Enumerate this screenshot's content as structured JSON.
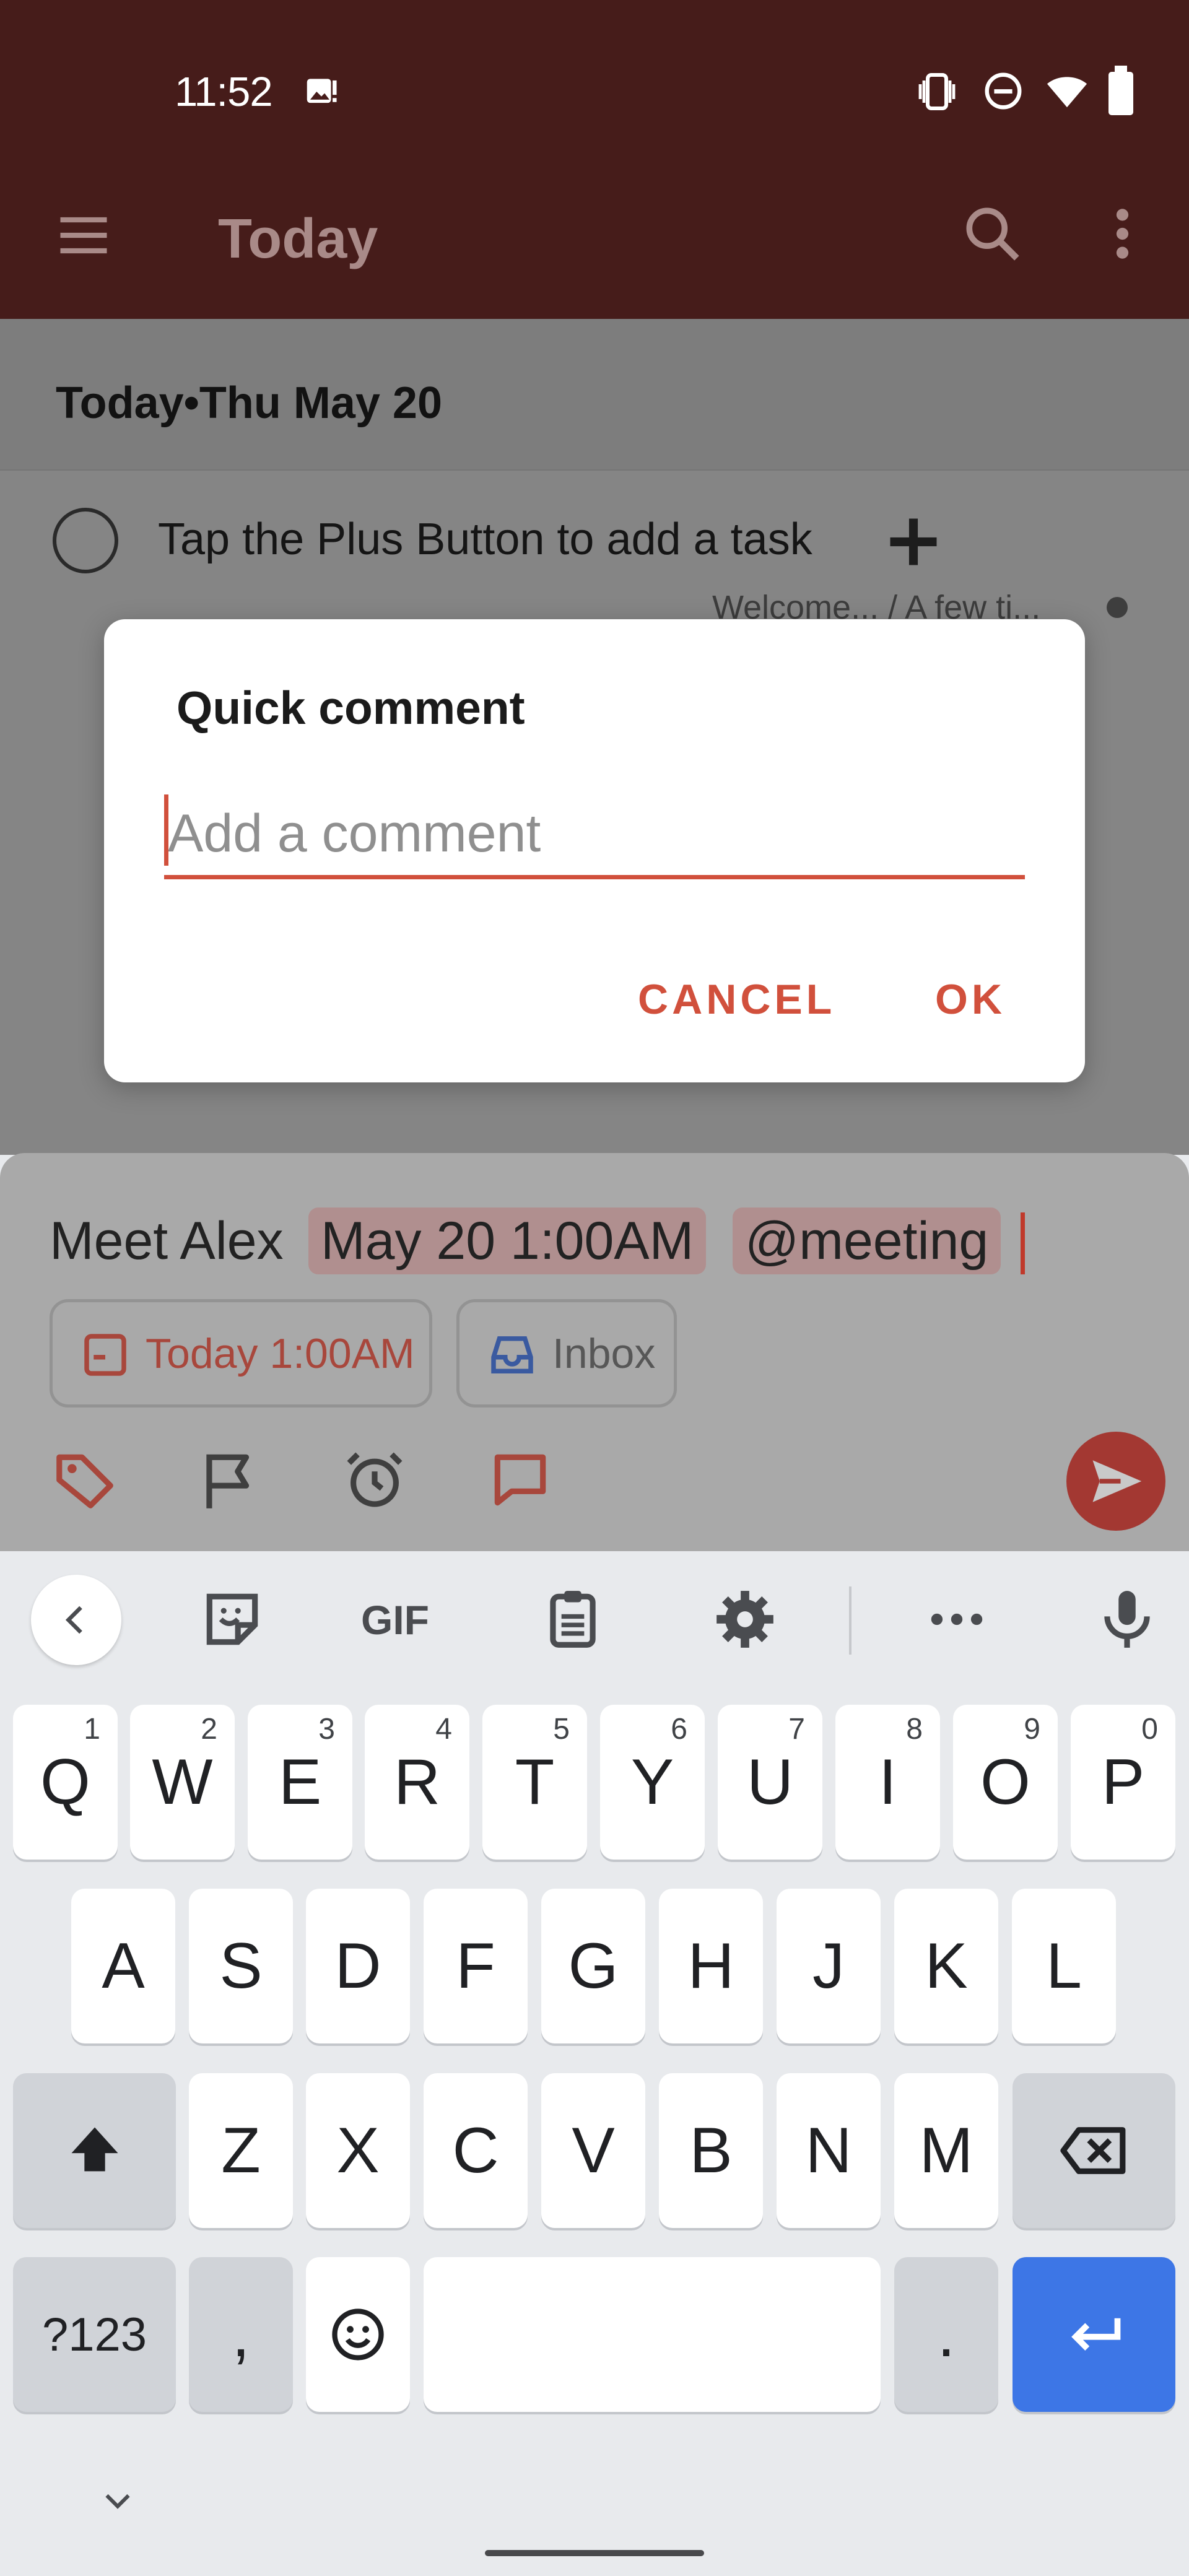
{
  "status_bar": {
    "time": "11:52",
    "icons": [
      "image-notification-icon",
      "vibrate-icon",
      "do-not-disturb-icon",
      "wifi-icon",
      "battery-icon"
    ]
  },
  "app_bar": {
    "title": "Today",
    "icons": [
      "menu-icon",
      "search-icon",
      "more-vert-icon"
    ]
  },
  "list": {
    "section_header": "Today•Thu May 20",
    "task": {
      "text": "Tap the Plus Button to add a task",
      "meta": "Welcome... / A few ti..."
    }
  },
  "dialog": {
    "title": "Quick comment",
    "placeholder": "Add a comment",
    "value": "",
    "cancel_label": "CANCEL",
    "ok_label": "OK"
  },
  "quick_add": {
    "text_plain": "Meet Alex",
    "date_token": "May 20 1:00AM",
    "label_token": "@meeting",
    "chip_date": "Today 1:00AM",
    "chip_project": "Inbox",
    "tools": [
      "label-icon",
      "flag-icon",
      "alarm-icon",
      "comment-icon"
    ],
    "send_icon": "send-icon"
  },
  "keyboard": {
    "toolbar": [
      "back-icon",
      "sticker-icon",
      "GIF",
      "clipboard-icon",
      "settings-icon",
      "more-horiz-icon",
      "mic-icon"
    ],
    "row1": [
      "Q",
      "W",
      "E",
      "R",
      "T",
      "Y",
      "U",
      "I",
      "O",
      "P"
    ],
    "row1_hints": [
      "1",
      "2",
      "3",
      "4",
      "5",
      "6",
      "7",
      "8",
      "9",
      "0"
    ],
    "row2": [
      "A",
      "S",
      "D",
      "F",
      "G",
      "H",
      "J",
      "K",
      "L"
    ],
    "row3": [
      "Z",
      "X",
      "C",
      "V",
      "B",
      "N",
      "M"
    ],
    "row4": {
      "symbols": "?123",
      "comma": ",",
      "period": "."
    }
  },
  "colors": {
    "app_bar": "#461c1a",
    "accent": "#d1503c",
    "send": "#a33832",
    "enter_key": "#3d76e6",
    "keyboard_bg": "#e8eaed"
  }
}
